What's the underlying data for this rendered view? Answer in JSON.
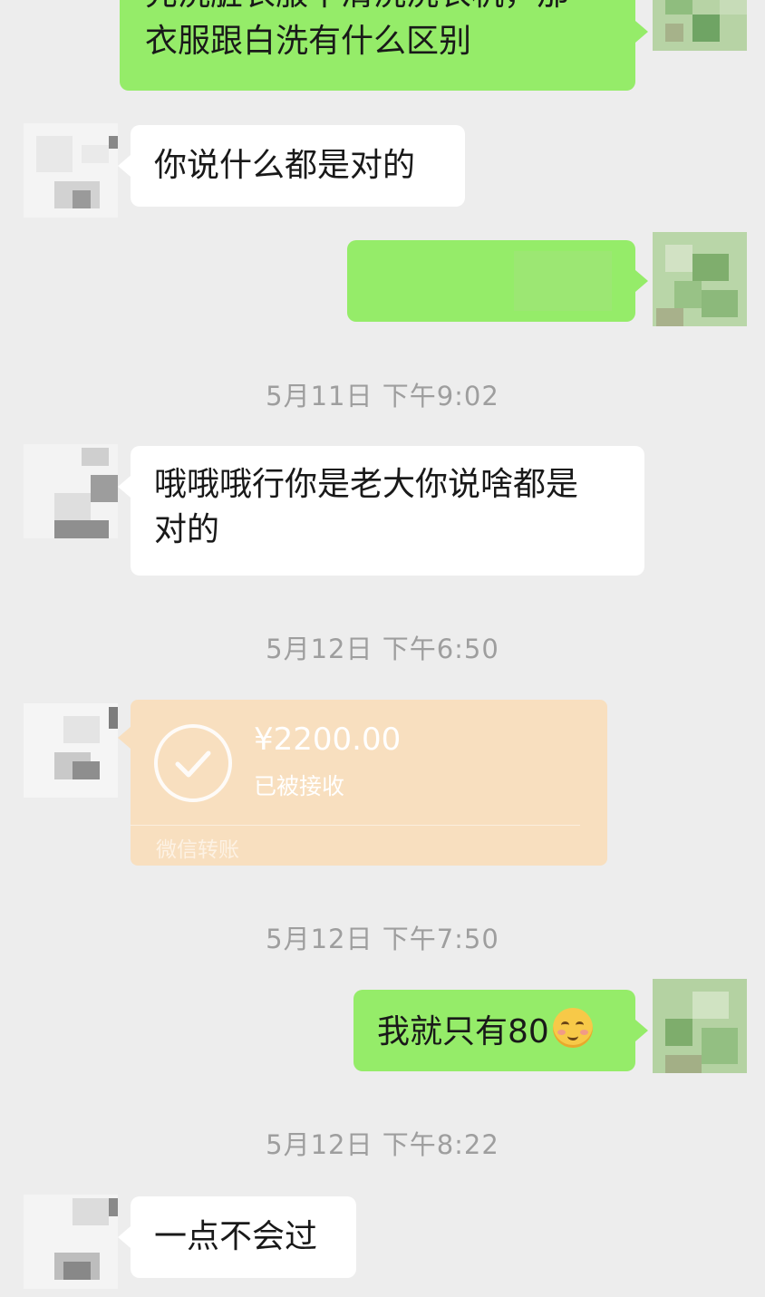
{
  "chat": {
    "messages": [
      {
        "side": "right",
        "text_line1": "先洗脏衣服不清洗洗衣机，那",
        "text_line2": "衣服跟白洗有什么区别"
      },
      {
        "side": "left",
        "text": "你说什么都是对的"
      },
      {
        "side": "right",
        "text": ""
      },
      {
        "side": "left",
        "text_line1": "哦哦哦行你是老大你说啥都是",
        "text_line2": "对的"
      },
      {
        "side": "left",
        "type": "transfer",
        "amount": "¥2200.00",
        "status": "已被接收",
        "footer": "微信转账"
      },
      {
        "side": "right",
        "text": "我就只有80",
        "emoji": "relieved-face-emoji"
      },
      {
        "side": "left",
        "text": "一点不会过"
      }
    ],
    "timestamps": [
      "5月11日 下午9:02",
      "5月12日 下午6:50",
      "5月12日 下午7:50",
      "5月12日 下午8:22"
    ]
  },
  "colors": {
    "background": "#ededed",
    "sent_bubble": "#95ec69",
    "received_bubble": "#ffffff",
    "transfer_card": "#f8dfbf",
    "timestamp_text": "#9e9e9e"
  }
}
